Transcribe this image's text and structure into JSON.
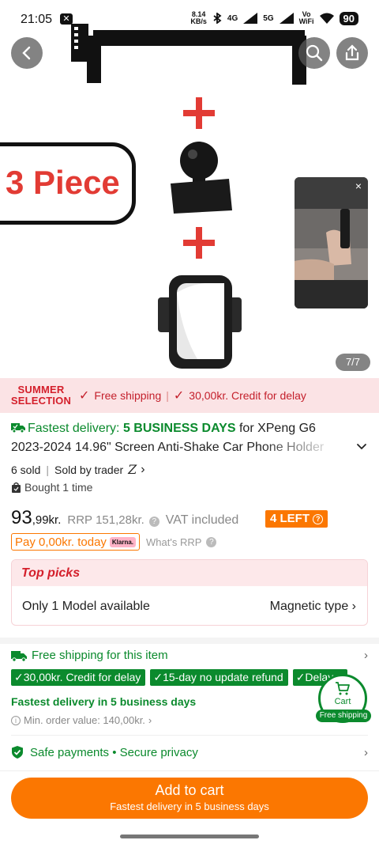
{
  "status_bar": {
    "time": "21:05",
    "speed": "8.14",
    "speed_unit": "KB/s",
    "network_4g": "4G",
    "network_5g": "5G",
    "vowifi_top": "Vo",
    "vowifi_bottom": "WiFi",
    "battery": "90"
  },
  "hero": {
    "badge_text": "3 Piece",
    "image_counter": "7/7",
    "video_close": "×"
  },
  "summer": {
    "logo_line1": "SUMMER",
    "logo_line2": "SELECTION",
    "item1": "Free shipping",
    "item2": "30,00kr. Credit for delay",
    "accent": "#d41f2b"
  },
  "product": {
    "fast_label": "Fastest delivery:",
    "fast_days": "5 BUSINESS DAYS",
    "title_line1_rest": "for XPeng G6",
    "title_line2": "2023-2024 14.96\" Screen Anti-Shake Car Phone Holder",
    "sold": "6 sold",
    "sold_by": "Sold by trader",
    "trader_logo": "Z",
    "bought": "Bought 1 time"
  },
  "price": {
    "integer": "93",
    "decimal": ",99kr.",
    "rrp_label": "RRP",
    "rrp_value": "151,28kr.",
    "vat": "VAT included",
    "left_badge": "4 LEFT",
    "pay_today": "Pay 0,00kr. today",
    "klarna": "Klarna.",
    "whats_rrp": "What's RRP",
    "accent": "#fb7701"
  },
  "top_picks": {
    "title": "Top picks",
    "model": "Only 1 Model available",
    "type": "Magnetic type"
  },
  "shipping": {
    "free_item": "Free shipping for this item",
    "tags": [
      "30,00kr. Credit for delay",
      "15-day no update refund",
      "Delay n"
    ],
    "fast_delivery": "Fastest delivery in 5 business days",
    "min_order": "Min. order value: 140,00kr.",
    "color": "#0b8a2d"
  },
  "cart_float": {
    "label": "Cart",
    "pill": "Free shipping"
  },
  "safe": {
    "text": "Safe payments • Secure privacy"
  },
  "add_to_cart": {
    "label": "Add to cart",
    "sub": "Fastest delivery in 5 business days"
  }
}
